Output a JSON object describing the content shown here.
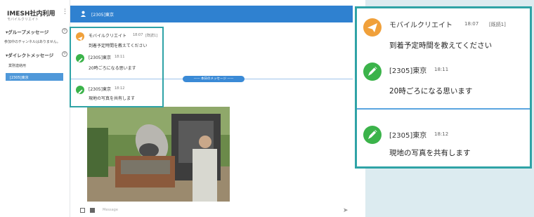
{
  "sidebar": {
    "workspace_title": "IMESH社内利用",
    "workspace_sub": "モバイルクリエイト",
    "menu_icon": "⋮",
    "groups_header": "▾グループメッセージ",
    "groups_item": "参加中のチャンネルはありません。",
    "dm_header": "▾ダイレクトメッセージ",
    "dm_items": [
      "業務連絡用",
      "[2305]東京"
    ],
    "add_icon": "+"
  },
  "channel": {
    "name": "[2305]東京",
    "icon": "user-icon"
  },
  "date_separator": "—— 本日のメッセージ ——",
  "small_messages": [
    {
      "name": "モバイルクリエイト",
      "time": "18:07",
      "read": "[既読1]",
      "text": "到着予定時間を教えてください",
      "avatar": "paper-plane-icon",
      "color": "#f0a03a"
    },
    {
      "name": "[2305]東京",
      "time": "18:11",
      "read": "",
      "text": "20時ごろになる思います",
      "avatar": "pen-icon",
      "color": "#3bb34a"
    },
    {
      "name": "[2305]東京",
      "time": "18:12",
      "read": "",
      "text": "現地の写真を共有します",
      "avatar": "pen-icon",
      "color": "#3bb34a"
    }
  ],
  "zoom_messages": [
    {
      "name": "モバイルクリエイト",
      "time": "18:07",
      "read": "[既読1]",
      "text": "到着予定時間を教えてください"
    },
    {
      "name": "[2305]東京",
      "time": "18:11",
      "read": "",
      "text": "20時ごろになる思います"
    },
    {
      "name": "[2305]東京",
      "time": "18:12",
      "read": "",
      "text": "現地の写真を共有します"
    }
  ],
  "composer": {
    "placeholder": "Message",
    "send_icon": "send-icon"
  },
  "colors": {
    "header_blue": "#2f81d0",
    "highlight_teal": "#2fa3a6",
    "orange": "#f0a03a",
    "green": "#3bb34a"
  }
}
